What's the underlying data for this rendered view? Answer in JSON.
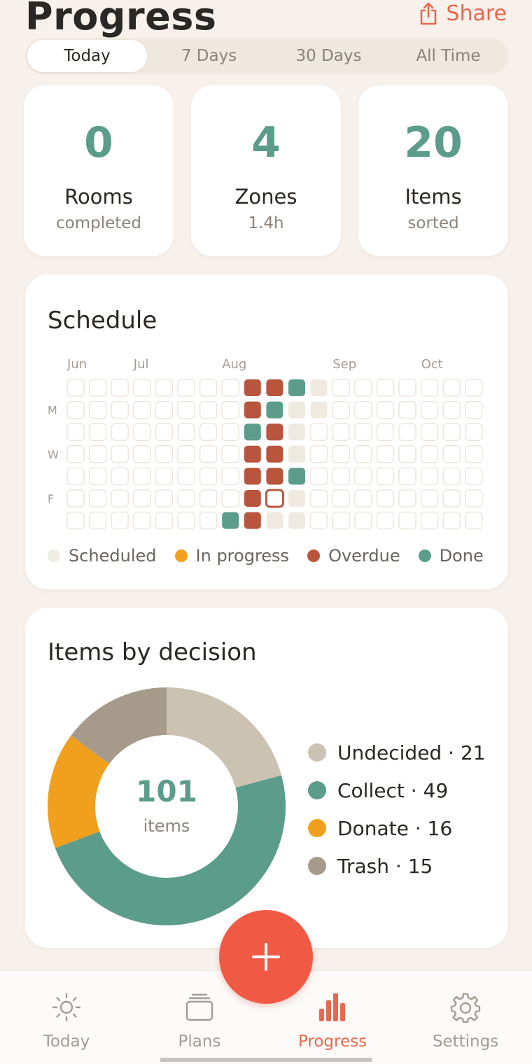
{
  "header": {
    "title": "Progress",
    "share_label": "Share"
  },
  "segments": [
    "Today",
    "7 Days",
    "30 Days",
    "All Time"
  ],
  "selected_segment": "Today",
  "stats": [
    {
      "value": "0",
      "label": "Rooms",
      "sub": "completed"
    },
    {
      "value": "4",
      "label": "Zones",
      "sub": "1.4h"
    },
    {
      "value": "20",
      "label": "Items",
      "sub": "sorted"
    }
  ],
  "schedule": {
    "title": "Schedule",
    "months": [
      "Jun",
      "Jul",
      "Aug",
      "Sep",
      "Oct"
    ],
    "weekday_labels": [
      "",
      "M",
      "",
      "W",
      "",
      "F",
      ""
    ],
    "columns": 19,
    "statuses": [
      "empty",
      "scheduled",
      "in_progress",
      "overdue",
      "done",
      "today"
    ],
    "grid": [
      [
        0,
        0,
        0,
        0,
        0,
        0,
        0,
        0,
        3,
        3,
        4,
        1,
        0,
        0,
        0,
        0,
        0,
        0,
        0
      ],
      [
        0,
        0,
        0,
        0,
        0,
        0,
        0,
        0,
        3,
        4,
        1,
        1,
        0,
        0,
        0,
        0,
        0,
        0,
        0
      ],
      [
        0,
        0,
        0,
        0,
        0,
        0,
        0,
        0,
        4,
        3,
        1,
        0,
        0,
        0,
        0,
        0,
        0,
        0,
        0
      ],
      [
        0,
        0,
        0,
        0,
        0,
        0,
        0,
        0,
        3,
        3,
        1,
        0,
        0,
        0,
        0,
        0,
        0,
        0,
        0
      ],
      [
        0,
        0,
        0,
        0,
        0,
        0,
        0,
        0,
        3,
        3,
        4,
        0,
        0,
        0,
        0,
        0,
        0,
        0,
        0
      ],
      [
        0,
        0,
        0,
        0,
        0,
        0,
        0,
        0,
        3,
        5,
        1,
        0,
        0,
        0,
        0,
        0,
        0,
        0,
        0
      ],
      [
        0,
        0,
        0,
        0,
        0,
        0,
        0,
        4,
        3,
        1,
        1,
        0,
        0,
        0,
        0,
        0,
        0,
        0,
        0
      ]
    ],
    "legend": [
      {
        "label": "Scheduled",
        "color": "#f0ebe3"
      },
      {
        "label": "In progress",
        "color": "#f0a01c"
      },
      {
        "label": "Overdue",
        "color": "#b8553c"
      },
      {
        "label": "Done",
        "color": "#5c9c8a"
      }
    ]
  },
  "decision": {
    "title": "Items by decision",
    "total": "101",
    "unit": "items",
    "items": [
      {
        "label": "Undecided",
        "count": 21,
        "text": "Undecided · 21",
        "color": "#cbc2b2"
      },
      {
        "label": "Collect",
        "count": 49,
        "text": "Collect · 49",
        "color": "#5c9c8a"
      },
      {
        "label": "Donate",
        "count": 16,
        "text": "Donate · 16",
        "color": "#f0a01c"
      },
      {
        "label": "Trash",
        "count": 15,
        "text": "Trash · 15",
        "color": "#a69b8b"
      }
    ]
  },
  "fab": {
    "icon": "plus-icon"
  },
  "tabbar": [
    {
      "label": "Today",
      "icon": "sun-icon"
    },
    {
      "label": "Plans",
      "icon": "stack-icon"
    },
    {
      "label": "Progress",
      "icon": "bar-chart-icon",
      "active": true
    },
    {
      "label": "Settings",
      "icon": "gear-icon"
    }
  ],
  "colors": {
    "accent": "#e8674e",
    "teal": "#5c9c8a",
    "background": "#f8f1eb"
  }
}
